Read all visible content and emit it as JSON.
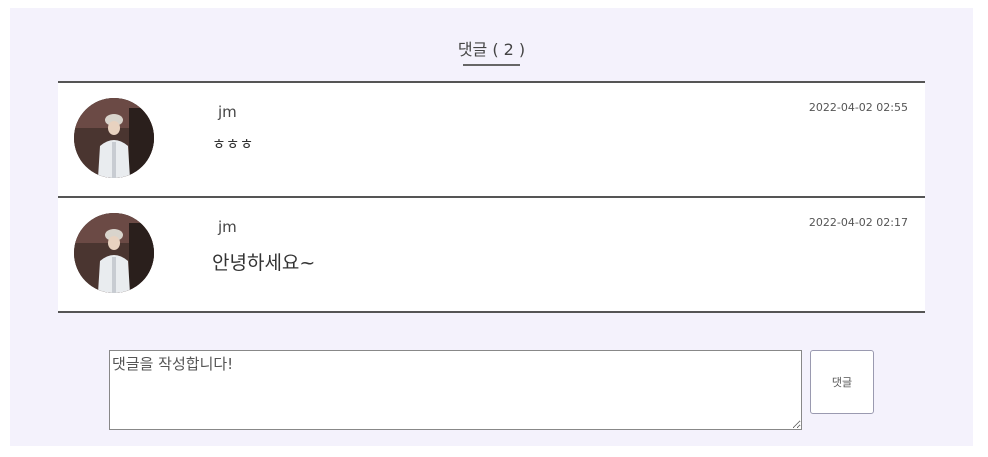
{
  "header": {
    "title": "댓글 ( 2 )"
  },
  "comments": [
    {
      "author": "jm",
      "date": "2022-04-02 02:55",
      "text": "ㅎㅎㅎ"
    },
    {
      "author": "jm",
      "date": "2022-04-02 02:17",
      "text": "안녕하세요~"
    }
  ],
  "composer": {
    "placeholder": "댓글을 작성합니다!",
    "submit_label": "댓글"
  }
}
